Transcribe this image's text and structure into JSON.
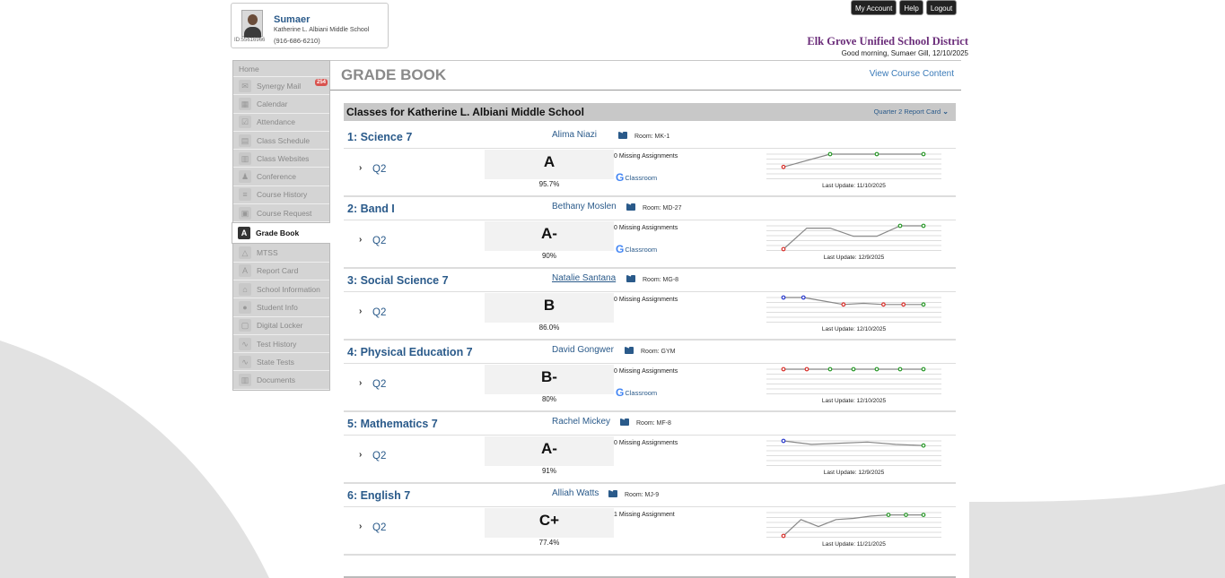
{
  "student": {
    "name": "Sumaer",
    "id": "ID:55616966",
    "school": "Katherine L. Albiani Middle School",
    "phone": "(916-686-6210)"
  },
  "top_buttons": [
    "My Account",
    "Help",
    "Logout"
  ],
  "district": "Elk Grove Unified School District",
  "greeting": "Good morning, Sumaer Gill, 12/10/2025",
  "nav": {
    "home": "Home",
    "items": [
      {
        "label": "Synergy Mail",
        "icon": "mail-icon",
        "badge": "254"
      },
      {
        "label": "Calendar",
        "icon": "calendar-icon"
      },
      {
        "label": "Attendance",
        "icon": "checkbox-icon"
      },
      {
        "label": "Class Schedule",
        "icon": "schedule-icon"
      },
      {
        "label": "Class Websites",
        "icon": "web-icon"
      },
      {
        "label": "Conference",
        "icon": "person-icon"
      },
      {
        "label": "Course History",
        "icon": "history-icon"
      },
      {
        "label": "Course Request",
        "icon": "request-icon"
      },
      {
        "label": "Grade Book",
        "icon": "gradebook-icon",
        "active": true
      },
      {
        "label": "MTSS",
        "icon": "mtss-icon"
      },
      {
        "label": "Report Card",
        "icon": "report-icon"
      },
      {
        "label": "School Information",
        "icon": "school-icon"
      },
      {
        "label": "Student Info",
        "icon": "student-icon"
      },
      {
        "label": "Digital Locker",
        "icon": "lock-icon"
      },
      {
        "label": "Test History",
        "icon": "chart-icon"
      },
      {
        "label": "State Tests",
        "icon": "chart-icon"
      },
      {
        "label": "Documents",
        "icon": "documents-icon"
      }
    ]
  },
  "page": {
    "title": "GRADE BOOK",
    "view_link": "View Course Content",
    "classes_header": "Classes for Katherine L. Albiani Middle School",
    "period_selector": "Quarter 2 Report Card"
  },
  "courses": [
    {
      "name": "1: Science 7",
      "teacher": "Alima Niazi",
      "room": "Room: MK-1",
      "quarter": "Q2",
      "grade": "A",
      "percent": "95.7%",
      "missing": "0 Missing Assignments",
      "classroom": "Classroom",
      "last_update": "Last Update: 11/10/2025",
      "trend": [
        {
          "v": 0.45,
          "c": "red"
        },
        {
          "v": 1.0,
          "c": "green"
        },
        {
          "v": 1.0,
          "c": "green"
        },
        {
          "v": 1.0,
          "c": "green"
        }
      ]
    },
    {
      "name": "2: Band I",
      "teacher": "Bethany Moslen",
      "room": "Room: MD-27",
      "quarter": "Q2",
      "grade": "A-",
      "percent": "90%",
      "missing": "0 Missing Assignments",
      "classroom": "Classroom",
      "last_update": "Last Update: 12/9/2025",
      "trend": [
        {
          "v": 0.0,
          "c": "red"
        },
        {
          "v": 0.9,
          "c": "none"
        },
        {
          "v": 0.9,
          "c": "none"
        },
        {
          "v": 0.55,
          "c": "none"
        },
        {
          "v": 0.55,
          "c": "none"
        },
        {
          "v": 1.0,
          "c": "green"
        },
        {
          "v": 1.0,
          "c": "green"
        }
      ]
    },
    {
      "name": "3: Social Science 7",
      "teacher": "Natalie Santana",
      "room": "Room: MG-8",
      "quarter": "Q2",
      "grade": "B",
      "percent": "86.0%",
      "missing": "0 Missing Assignments",
      "classroom": "",
      "last_update": "Last Update: 12/10/2025",
      "trend": [
        {
          "v": 1.0,
          "c": "blue"
        },
        {
          "v": 1.0,
          "c": "blue"
        },
        {
          "v": 0.85,
          "c": "none"
        },
        {
          "v": 0.7,
          "c": "red"
        },
        {
          "v": 0.75,
          "c": "none"
        },
        {
          "v": 0.7,
          "c": "red"
        },
        {
          "v": 0.7,
          "c": "red"
        },
        {
          "v": 0.7,
          "c": "green"
        }
      ]
    },
    {
      "name": "4: Physical Education 7",
      "teacher": "David Gongwer",
      "room": "Room: GYM",
      "quarter": "Q2",
      "grade": "B-",
      "percent": "80%",
      "missing": "0 Missing Assignments",
      "classroom": "Classroom",
      "last_update": "Last Update: 12/10/2025",
      "trend": [
        {
          "v": 1.0,
          "c": "red"
        },
        {
          "v": 1.0,
          "c": "red"
        },
        {
          "v": 1.0,
          "c": "green"
        },
        {
          "v": 1.0,
          "c": "green"
        },
        {
          "v": 1.0,
          "c": "green"
        },
        {
          "v": 1.0,
          "c": "green"
        },
        {
          "v": 1.0,
          "c": "green"
        }
      ]
    },
    {
      "name": "5: Mathematics 7",
      "teacher": "Rachel Mickey",
      "room": "Room: MF-8",
      "quarter": "Q2",
      "grade": "A-",
      "percent": "91%",
      "missing": "0 Missing Assignments",
      "classroom": "",
      "last_update": "Last Update: 12/9/2025",
      "trend": [
        {
          "v": 1.0,
          "c": "blue"
        },
        {
          "v": 0.85,
          "c": "none"
        },
        {
          "v": 0.9,
          "c": "none"
        },
        {
          "v": 0.95,
          "c": "none"
        },
        {
          "v": 0.85,
          "c": "none"
        },
        {
          "v": 0.8,
          "c": "green"
        }
      ]
    },
    {
      "name": "6: English 7",
      "teacher": "Alliah Watts",
      "room": "Room: MJ-9",
      "quarter": "Q2",
      "grade": "C+",
      "percent": "77.4%",
      "missing": "1 Missing Assignment",
      "classroom": "",
      "last_update": "Last Update: 11/21/2025",
      "trend": [
        {
          "v": 0.0,
          "c": "red"
        },
        {
          "v": 0.7,
          "c": "none"
        },
        {
          "v": 0.4,
          "c": "none"
        },
        {
          "v": 0.7,
          "c": "none"
        },
        {
          "v": 0.75,
          "c": "none"
        },
        {
          "v": 0.85,
          "c": "none"
        },
        {
          "v": 0.9,
          "c": "green"
        },
        {
          "v": 0.9,
          "c": "green"
        },
        {
          "v": 0.9,
          "c": "green"
        }
      ]
    }
  ],
  "colors": {
    "link": "#2a5a8a",
    "district": "#6b2d7a",
    "red": "#d9302b",
    "green": "#2a9a2a",
    "blue": "#2a3acd"
  }
}
